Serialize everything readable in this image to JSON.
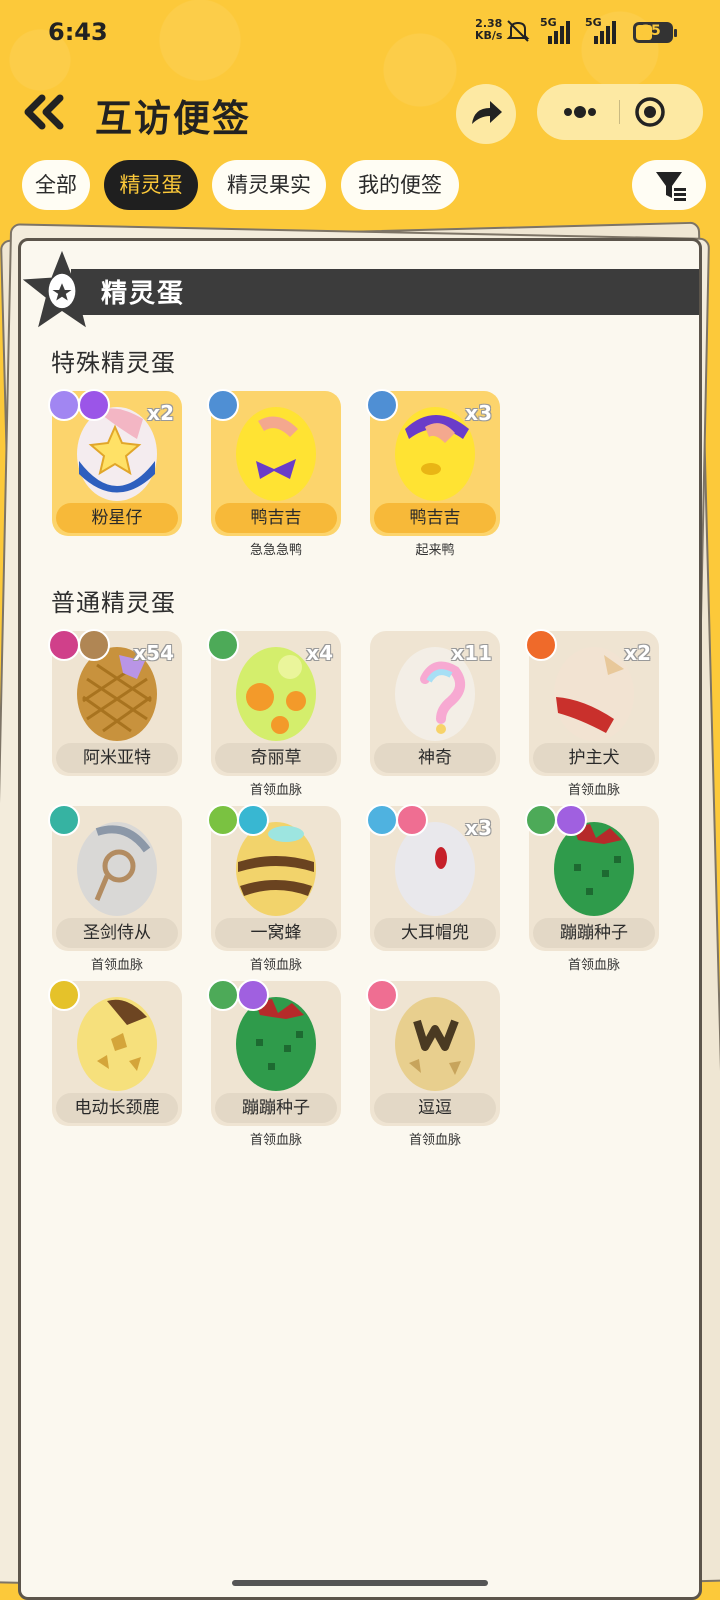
{
  "status": {
    "time": "6:43",
    "net_speed": "2.38",
    "net_unit": "KB/s",
    "battery": "35",
    "signal1": "5G",
    "signal2": "5G"
  },
  "header": {
    "title": "互访便签"
  },
  "tabs": [
    {
      "label": "全部"
    },
    {
      "label": "精灵蛋"
    },
    {
      "label": "精灵果实"
    },
    {
      "label": "我的便签"
    }
  ],
  "section": {
    "title": "精灵蛋"
  },
  "special": {
    "title": "特殊精灵蛋",
    "items": [
      {
        "name": "粉星仔",
        "count": "x2",
        "sub": ""
      },
      {
        "name": "鸭吉吉",
        "count": "",
        "sub": "急急急鸭"
      },
      {
        "name": "鸭吉吉",
        "count": "x3",
        "sub": "起来鸭"
      }
    ]
  },
  "normal": {
    "title": "普通精灵蛋",
    "items": [
      {
        "name": "阿米亚特",
        "count": "x54",
        "sub": ""
      },
      {
        "name": "奇丽草",
        "count": "x4",
        "sub": "首领血脉"
      },
      {
        "name": "神奇",
        "count": "x11",
        "sub": ""
      },
      {
        "name": "护主犬",
        "count": "x2",
        "sub": "首领血脉"
      },
      {
        "name": "圣剑侍从",
        "count": "",
        "sub": "首领血脉"
      },
      {
        "name": "一窝蜂",
        "count": "",
        "sub": "首领血脉"
      },
      {
        "name": "大耳帽兜",
        "count": "x3",
        "sub": ""
      },
      {
        "name": "蹦蹦种子",
        "count": "",
        "sub": "首领血脉"
      },
      {
        "name": "电动长颈鹿",
        "count": "",
        "sub": ""
      },
      {
        "name": "蹦蹦种子",
        "count": "",
        "sub": "首领血脉"
      },
      {
        "name": "逗逗",
        "count": "",
        "sub": "首领血脉"
      }
    ]
  },
  "colors": {
    "background": "#fcc93a",
    "active_tab": "#1f1f1f",
    "special_card": "#fcd46c",
    "normal_card": "#efe4d2"
  }
}
